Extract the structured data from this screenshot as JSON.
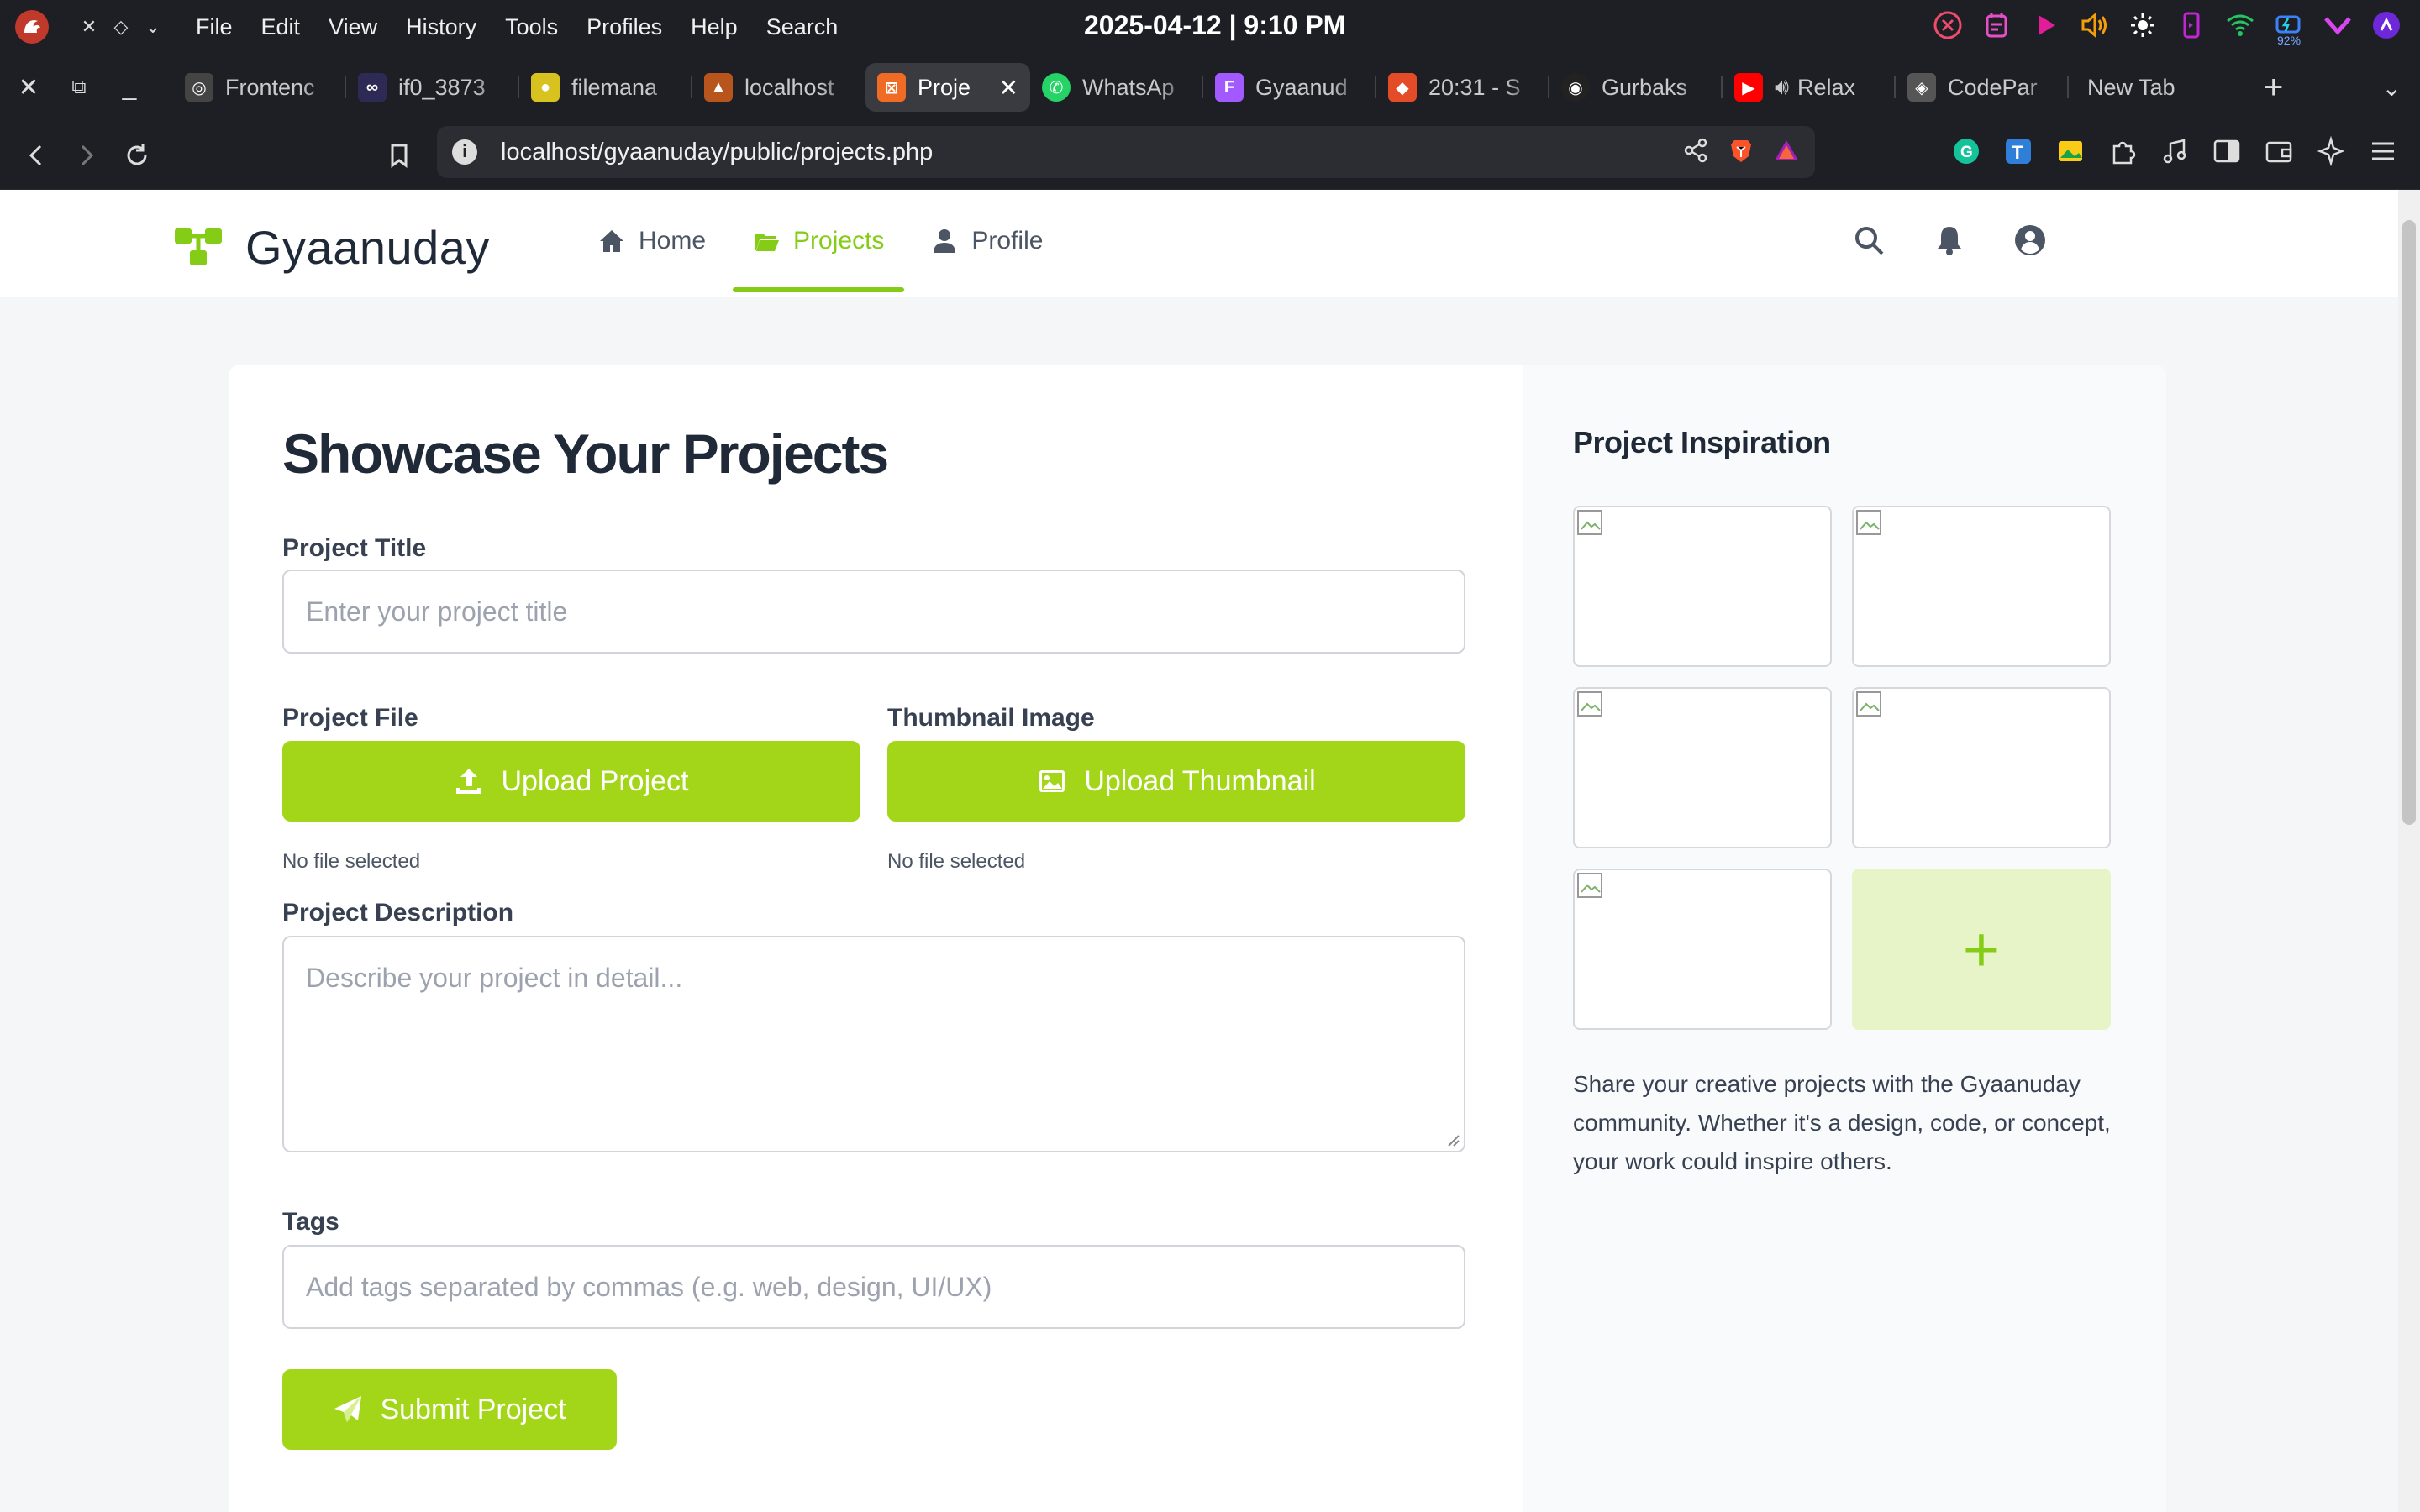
{
  "os": {
    "menu": [
      "File",
      "Edit",
      "View",
      "History",
      "Tools",
      "Profiles",
      "Help",
      "Search"
    ],
    "clock": "2025-04-12 | 9:10 PM",
    "battery": "92%"
  },
  "tabs": [
    {
      "title": "Frontenc",
      "fav_color": "#444"
    },
    {
      "title": "if0_3873",
      "fav_color": "#2d2b55"
    },
    {
      "title": "filemana",
      "fav_color": "#d7c21f"
    },
    {
      "title": "localhost",
      "fav_color": "#b8551d"
    },
    {
      "title": "Proje",
      "fav_color": "#f06b24",
      "active": true
    },
    {
      "title": "WhatsAp",
      "fav_color": "#25d366"
    },
    {
      "title": "Gyaanud",
      "fav_color": "#a259ff"
    },
    {
      "title": "20:31 - S",
      "fav_color": "#e34c26"
    },
    {
      "title": "Gurbaks",
      "fav_color": "#222"
    },
    {
      "title": "Relax",
      "fav_color": "#ff0000"
    },
    {
      "title": "CodePar",
      "fav_color": "#555"
    },
    {
      "title": "New Tab",
      "fav_color": ""
    }
  ],
  "address": {
    "url": "localhost/gyaanuday/public/projects.php"
  },
  "site": {
    "brand": "Gyaanuday",
    "nav": [
      {
        "label": "Home",
        "icon": "home-icon"
      },
      {
        "label": "Projects",
        "icon": "folder-open-icon",
        "active": true
      },
      {
        "label": "Profile",
        "icon": "user-icon"
      }
    ],
    "accent": "#84cc16",
    "button_color": "#a3d619"
  },
  "form": {
    "title": "Showcase Your Projects",
    "project_title_label": "Project Title",
    "project_title_placeholder": "Enter your project title",
    "project_file_label": "Project File",
    "upload_project_label": "Upload Project",
    "project_file_status": "No file selected",
    "thumbnail_label": "Thumbnail Image",
    "upload_thumbnail_label": "Upload Thumbnail",
    "thumbnail_status": "No file selected",
    "description_label": "Project Description",
    "description_placeholder": "Describe your project in detail...",
    "tags_label": "Tags",
    "tags_placeholder": "Add tags separated by commas (e.g. web, design, UI/UX)",
    "submit_label": "Submit Project"
  },
  "sidebar": {
    "title": "Project Inspiration",
    "add_label": "+",
    "text": "Share your creative projects with the Gyaanuday community. Whether it's a design, code, or concept, your work could inspire others."
  }
}
